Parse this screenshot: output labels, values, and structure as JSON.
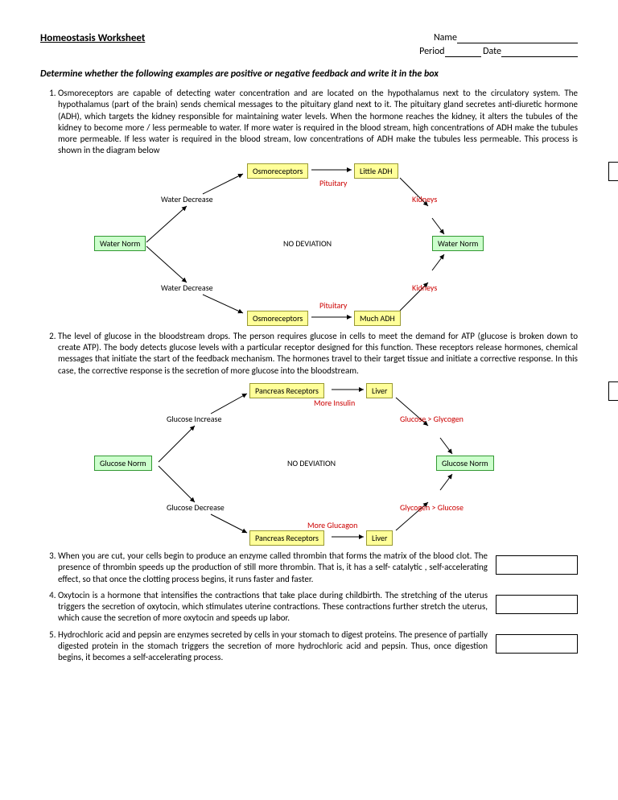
{
  "header": {
    "title": "Homeostasis Worksheet",
    "name_label": "Name",
    "period_label": "Period",
    "date_label": "Date"
  },
  "instruction": "Determine whether the following examples are positive or negative feedback and write it in the box",
  "q1": {
    "text": "Osmoreceptors are capable of detecting water concentration and are located on the hypothalamus next to the circulatory system. The hypothalamus (part of the brain) sends chemical messages to the pituitary gland next to it. The pituitary gland secretes anti-diuretic hormone (ADH), which targets the kidney responsible for maintaining water levels. When the hormone reaches the kidney, it alters the tubules of the kidney to become more / less permeable to water. If more water is required in the blood stream, high concentrations of ADH make the tubules more permeable. If less water is required in the blood stream, low concentrations of ADH make the tubules less permeable. This process is shown in the diagram below"
  },
  "q2": {
    "text": "The level of glucose in the bloodstream drops. The person requires glucose in cells to meet the demand for ATP (glucose is broken down to create ATP). The body detects glucose levels with a particular receptor designed for this function. These receptors release hormones, chemical messages that initiate the start of the feedback mechanism. The hormones travel to their target tissue and initiate a corrective response. In this case, the corrective response is the secretion of more glucose into the bloodstream."
  },
  "q3": {
    "text": "When you are cut, your cells begin to produce an enzyme called thrombin that forms the matrix of the blood clot. The presence of thrombin speeds up the production of still more thrombin. That is, it has a self- catalytic , self-accelerating effect, so that once the clotting process begins, it runs faster and faster."
  },
  "q4": {
    "text": "Oxytocin is a hormone that intensifies the contractions that take place during childbirth. The stretching of the uterus triggers the secretion of oxytocin, which stimulates uterine contractions. These contractions further stretch the uterus, which cause the secretion of more oxytocin and speeds up labor."
  },
  "q5": {
    "text": "Hydrochloric acid and pepsin are enzymes secreted by cells in your stomach to digest proteins. The presence of partially digested protein in the stomach triggers the secretion of more hydrochloric acid and pepsin. Thus, once digestion begins, it becomes a self-accelerating process."
  },
  "diagram1": {
    "water_norm": "Water Norm",
    "osmoreceptors": "Osmoreceptors",
    "little_adh": "Little ADH",
    "much_adh": "Much ADH",
    "pituitary": "Pituitary",
    "kidneys": "Kidneys",
    "water_decrease": "Water Decrease",
    "no_deviation": "NO DEVIATION"
  },
  "diagram2": {
    "glucose_norm": "Glucose Norm",
    "pancreas_receptors": "Pancreas Receptors",
    "liver": "Liver",
    "more_insulin": "More Insulin",
    "more_glucagon": "More Glucagon",
    "glucose_to_glycogen": "Glucose > Glycogen",
    "glycogen_to_glucose": "Glycogen > Glucose",
    "glucose_increase": "Glucose Increase",
    "glucose_decrease": "Glucose Decrease",
    "no_deviation": "NO DEVIATION"
  }
}
